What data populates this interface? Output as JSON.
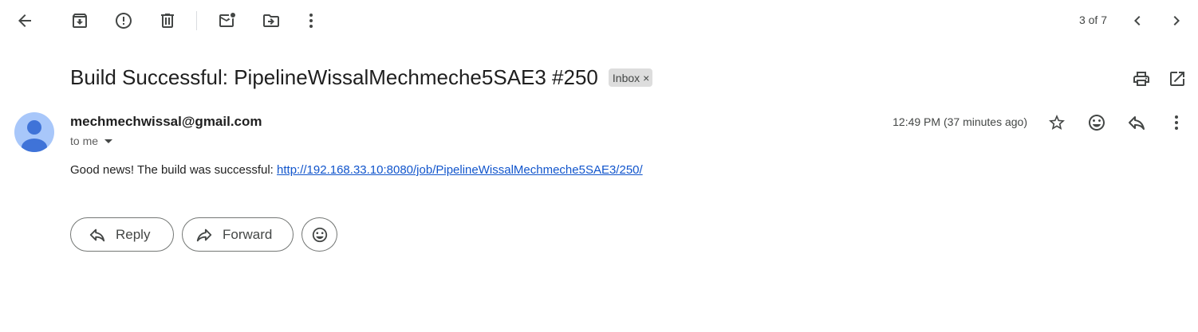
{
  "toolbar": {
    "page_counter": "3 of 7"
  },
  "message": {
    "subject": "Build Successful: PipelineWissalMechmeche5SAE3 #250",
    "label": "Inbox",
    "label_close": "×",
    "sender": "mechmechwissal@gmail.com",
    "recipient": "to me",
    "timestamp": "12:49 PM (37 minutes ago)",
    "body_text": "Good news! The build was successful: ",
    "body_link": "http://192.168.33.10:8080/job/PipelineWissalMechmeche5SAE3/250/"
  },
  "actions": {
    "reply_label": "Reply",
    "forward_label": "Forward"
  },
  "icons": {
    "back": "arrow-left-icon",
    "archive": "archive-icon",
    "spam": "report-spam-icon",
    "delete": "trash-icon",
    "mark_unread": "mark-unread-icon",
    "move": "move-to-icon",
    "more": "more-vert-icon",
    "prev": "chevron-left-icon",
    "next": "chevron-right-icon",
    "print": "print-icon",
    "open_new": "open-in-new-icon",
    "star": "star-icon",
    "emoji": "emoji-icon",
    "reply": "reply-icon",
    "forward": "forward-icon"
  },
  "colors": {
    "link": "#1155cc",
    "avatar": "#a8c7fa",
    "avatar_figure": "#3f73d8",
    "chip": "#dddddd"
  }
}
